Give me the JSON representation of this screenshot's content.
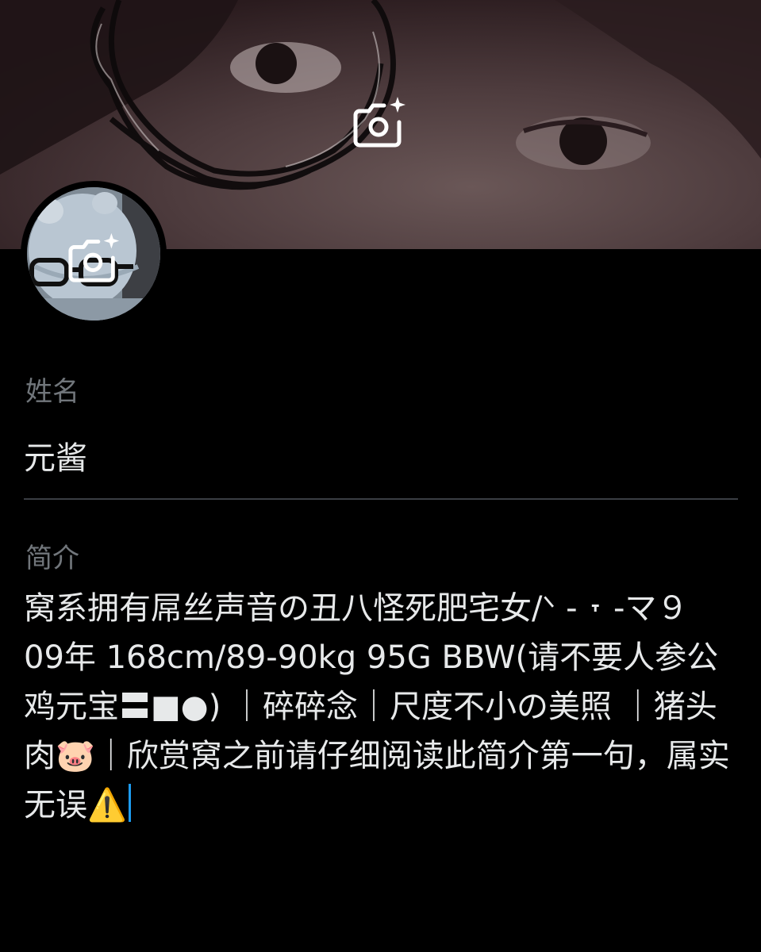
{
  "banner": {
    "camera_icon": "camera-sparkle-icon"
  },
  "avatar": {
    "camera_icon": "camera-sparkle-icon"
  },
  "name_field": {
    "label": "姓名",
    "value": "元酱"
  },
  "bio_field": {
    "label": "简介",
    "value": "窝系拥有屌丝声音の丑八怪死肥宅女/ᐠ - ˕ -マ９\n09年 168cm/89-90kg 95G BBW(请不要人参公鸡元宝〓■●) ｜碎碎念｜尺度不小の美照 ｜猪头肉🐷｜欣赏窝之前请仔细阅读此简介第一句，属实无误⚠️"
  },
  "colors": {
    "background": "#000000",
    "label": "#71767b",
    "text": "#e7e9ea",
    "divider": "#3a3e43",
    "caret": "#1d9bf0"
  }
}
